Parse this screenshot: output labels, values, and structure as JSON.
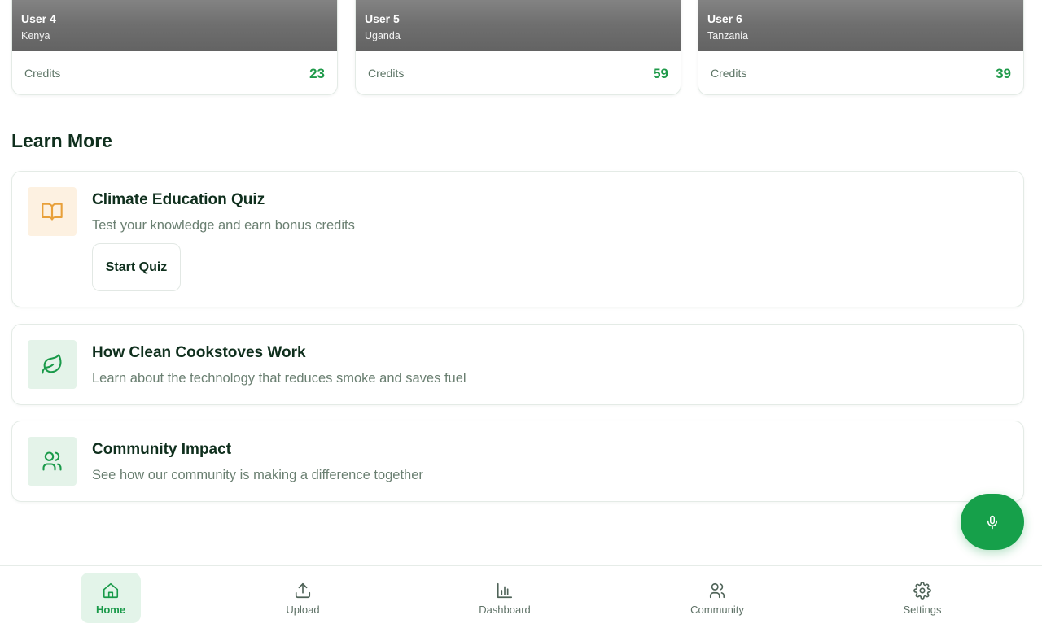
{
  "users": [
    {
      "name": "User 4",
      "country": "Kenya",
      "credits_label": "Credits",
      "credits": "23"
    },
    {
      "name": "User 5",
      "country": "Uganda",
      "credits_label": "Credits",
      "credits": "59"
    },
    {
      "name": "User 6",
      "country": "Tanzania",
      "credits_label": "Credits",
      "credits": "39"
    }
  ],
  "learn_more": {
    "title": "Learn More",
    "items": [
      {
        "icon": "book-open-icon",
        "title": "Climate Education Quiz",
        "description": "Test your knowledge and earn bonus credits",
        "button_label": "Start Quiz"
      },
      {
        "icon": "leaf-icon",
        "title": "How Clean Cookstoves Work",
        "description": "Learn about the technology that reduces smoke and saves fuel"
      },
      {
        "icon": "users-icon",
        "title": "Community Impact",
        "description": "See how our community is making a difference together"
      }
    ]
  },
  "mic_button": {
    "icon": "microphone-icon"
  },
  "nav": {
    "items": [
      {
        "icon": "home-icon",
        "label": "Home",
        "active": true
      },
      {
        "icon": "upload-icon",
        "label": "Upload"
      },
      {
        "icon": "bar-chart-icon",
        "label": "Dashboard"
      },
      {
        "icon": "users-icon",
        "label": "Community"
      },
      {
        "icon": "gear-icon",
        "label": "Settings"
      }
    ]
  },
  "colors": {
    "accent": "#16a04a",
    "credits": "#1f9a4a",
    "quiz_icon": "#e8a03a",
    "heading": "#0f2f1d",
    "muted": "#6a7f71"
  }
}
